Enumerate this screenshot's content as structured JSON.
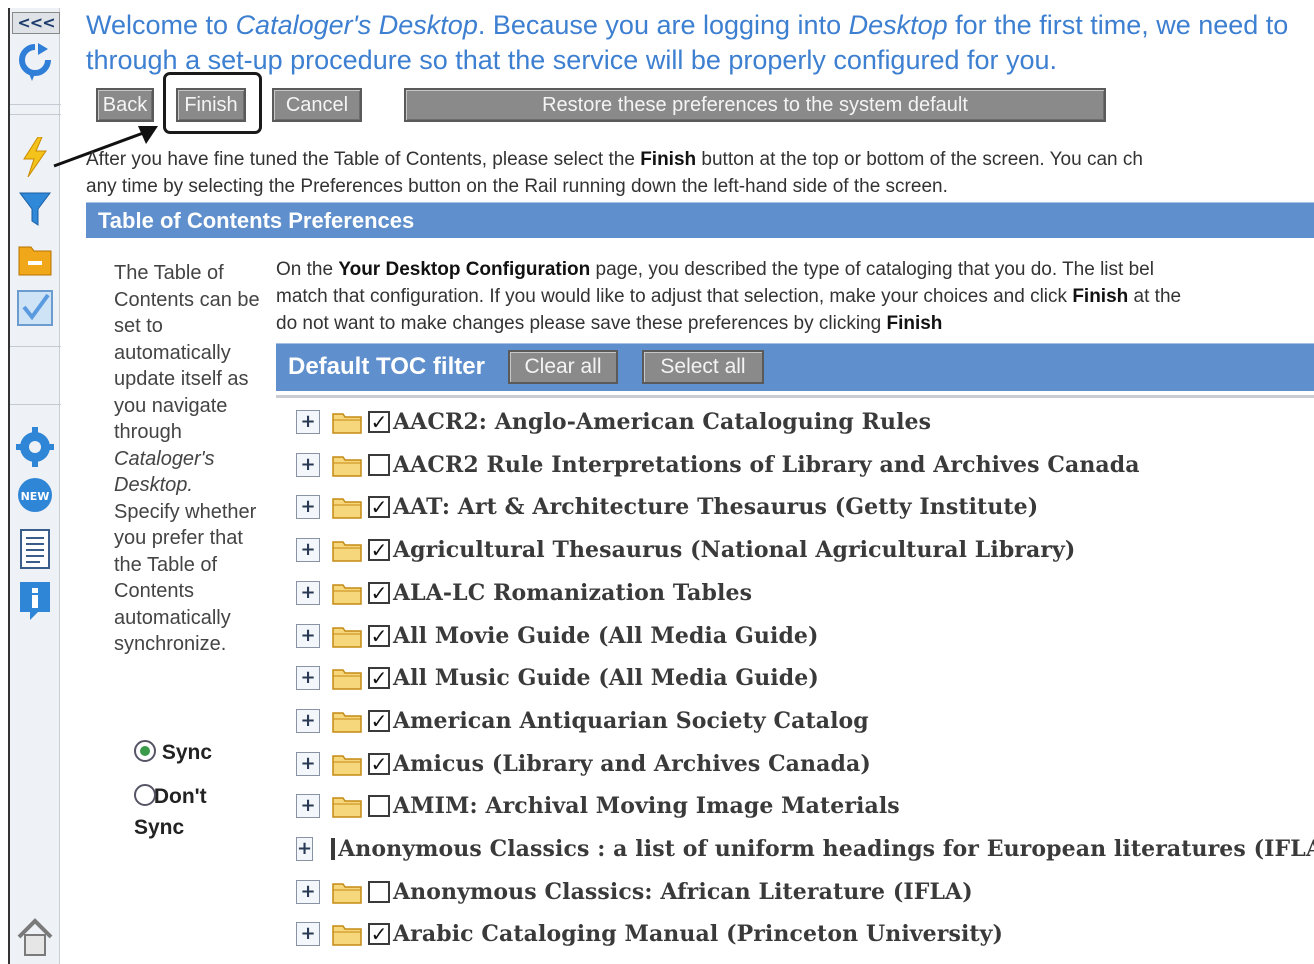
{
  "rail": {
    "collapse_label": "<<<",
    "icons": [
      "refresh-icon",
      "lightning-icon",
      "filter-icon",
      "folder-icon",
      "checkmark-icon",
      "gear-icon",
      "new-badge-icon",
      "document-icon",
      "info-icon",
      "home-icon"
    ]
  },
  "welcome": {
    "line1_a": "Welcome to ",
    "line1_b": "Cataloger's Desktop",
    "line1_c": ". Because you are logging into ",
    "line1_d": "Desktop",
    "line1_e": " for the first time, we need to",
    "line2": "through a set-up procedure so that the service will be properly configured for you."
  },
  "buttons": {
    "back": "Back",
    "finish": "Finish",
    "cancel": "Cancel",
    "restore": "Restore these preferences to the system default"
  },
  "intro": {
    "line1_a": "After you have fine tuned the Table of Contents, please select the ",
    "line1_b": "Finish",
    "line1_c": " button at the top or bottom of the screen. You can ch",
    "line2": "any time by selecting the Preferences button on the Rail running down the left-hand side of the screen."
  },
  "section_title": "Table of Contents Preferences",
  "sidebar": {
    "text_a": "The Table of Contents can be set to automatically update itself as you navigate through ",
    "text_b": "Cataloger's Desktop.",
    "text_c": " Specify whether you prefer that the Table of Contents automatically synchronize.",
    "radio_sync": "Sync",
    "radio_dont_sync": "Don't Sync",
    "selected": "Sync"
  },
  "config": {
    "line1_a": "On the ",
    "line1_b": "Your Desktop Configuration",
    "line1_c": " page, you described the type of cataloging that you do. The list bel",
    "line2_a": "match that configuration. If you would like to adjust that selection, make your choices and click ",
    "line2_b": "Finish",
    "line2_c": " at the",
    "line3_a": "do not want to make changes please save these preferences by clicking ",
    "line3_b": "Finish"
  },
  "filter": {
    "title": "Default TOC filter",
    "clear_all": "Clear all",
    "select_all": "Select all"
  },
  "toc_items": [
    {
      "label": "AACR2: Anglo-American Cataloguing Rules",
      "checked": true
    },
    {
      "label": "AACR2 Rule Interpretations of Library and Archives Canada",
      "checked": false
    },
    {
      "label": "AAT: Art & Architecture Thesaurus (Getty Institute)",
      "checked": true
    },
    {
      "label": "Agricultural Thesaurus (National Agricultural Library)",
      "checked": true
    },
    {
      "label": "ALA-LC Romanization Tables",
      "checked": true
    },
    {
      "label": "All Movie Guide (All Media Guide)",
      "checked": true
    },
    {
      "label": "All Music Guide (All Media Guide)",
      "checked": true
    },
    {
      "label": "American Antiquarian Society Catalog",
      "checked": true
    },
    {
      "label": "Amicus (Library and Archives Canada)",
      "checked": true
    },
    {
      "label": "AMIM: Archival Moving Image Materials",
      "checked": false
    },
    {
      "label": "Anonymous Classics : a list of uniform headings for European literatures (IFLA)",
      "checked": false
    },
    {
      "label": "Anonymous Classics: African Literature (IFLA)",
      "checked": false
    },
    {
      "label": "Arabic Cataloging Manual (Princeton University)",
      "checked": true
    }
  ],
  "colors": {
    "accent_blue": "#5f8fcc",
    "welcome_text": "#3d7fd0",
    "button_gray": "#8a8a8a"
  }
}
